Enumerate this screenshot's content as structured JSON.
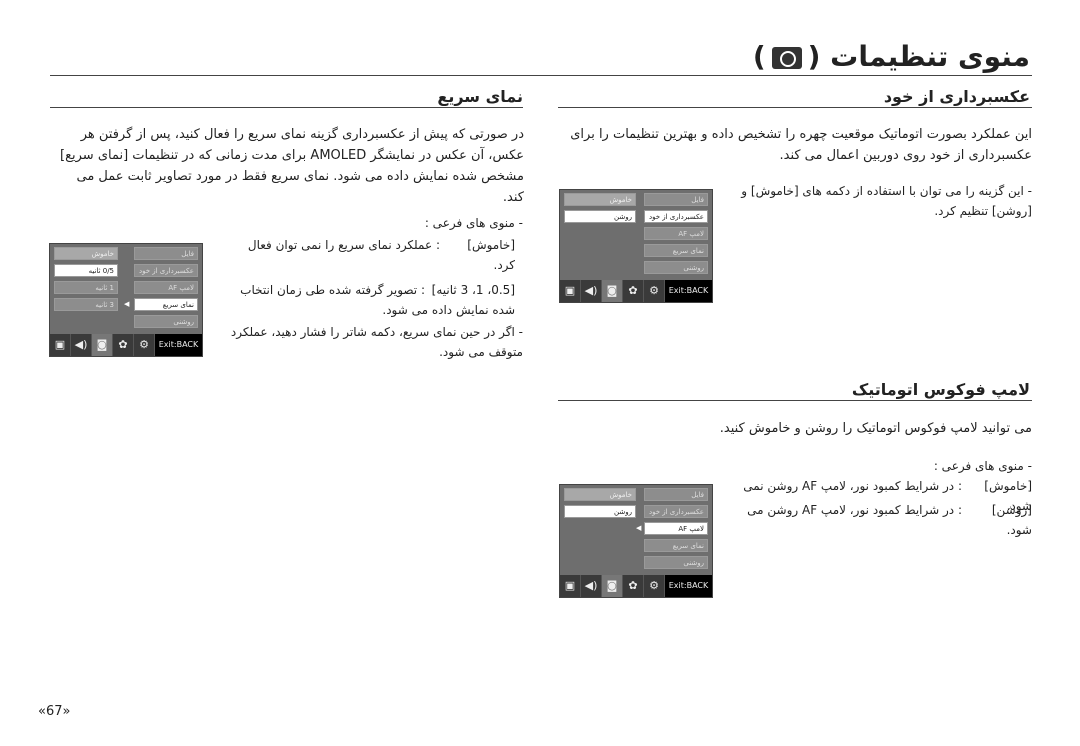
{
  "page_title": "منوی تنظیمات (",
  "page_title_close": ")",
  "sections": {
    "self_portrait": {
      "heading": "عکسبرداری از خود",
      "body": "این عملکرد بصورت اتوماتیک موقعیت چهره را تشخیص داده و بهترین تنظیمات را برای عکسبرداری از خود روی دوربین اعمال می کند.",
      "note": "- این گزینه را می توان با استفاده از دکمه های [خاموش] و [روشن] تنظیم کرد."
    },
    "quick_view": {
      "heading": "نمای سریع",
      "body": "در صورتی که پیش از عکسبرداری گزینه نمای سریع را فعال کنید، پس از گرفتن هر عکس، آن عکس در نمایشگر AMOLED برای مدت زمانی که در تنظیمات [نمای سریع] مشخص شده نمایش داده می شود. نمای سریع فقط در مورد تصاویر ثابت عمل می کند.",
      "submenu_label": "- منوی های فرعی :",
      "options": [
        {
          "key": "[خاموش]",
          "desc": ": عملکرد نمای سریع را نمی توان فعال کرد."
        },
        {
          "key": "[0.5، 1، 3 ثانیه]",
          "desc": ": تصویر گرفته شده طی زمان انتخاب شده نمایش داده می شود."
        }
      ],
      "note": "- اگر در حین نمای سریع، دکمه شاتر را فشار دهید، عملکرد متوقف می شود."
    },
    "af_lamp": {
      "heading": "لامپ فوکوس اتوماتیک",
      "body": "می توانید لامپ فوکوس اتوماتیک را روشن و خاموش کنید.",
      "submenu_label": "- منوی های فرعی :",
      "options": [
        {
          "key": "[خاموش]",
          "desc": ": در شرایط کمبود نور، لامپ AF روشن نمی شود."
        },
        {
          "key": "[روشن]",
          "desc": ": در شرایط کمبود نور، لامپ AF روشن می شود."
        }
      ]
    }
  },
  "screens": [
    {
      "menu": [
        "فایل",
        "عکسبرداری از خود",
        "لامپ AF",
        "نمای سریع",
        "روشنی"
      ],
      "sub": [
        "خاموش",
        "روشن"
      ],
      "exit": "Exit:BACK"
    },
    {
      "menu": [
        "فایل",
        "عکسبرداری از خود",
        "لامپ AF",
        "نمای سریع",
        "روشنی"
      ],
      "sub": [
        "خاموش",
        "0/5 ثانیه",
        "1 ثانیه",
        "3 ثانیه"
      ],
      "exit": "Exit:BACK"
    },
    {
      "menu": [
        "فایل",
        "عکسبرداری از خود",
        "لامپ AF",
        "نمای سریع",
        "روشنی"
      ],
      "sub": [
        "خاموش",
        "روشن"
      ],
      "exit": "Exit:BACK"
    }
  ],
  "screen_icons": [
    "display-icon",
    "sound-icon",
    "camera-settings-icon",
    "effects-icon",
    "gear-icon"
  ],
  "page_number": "«67»"
}
